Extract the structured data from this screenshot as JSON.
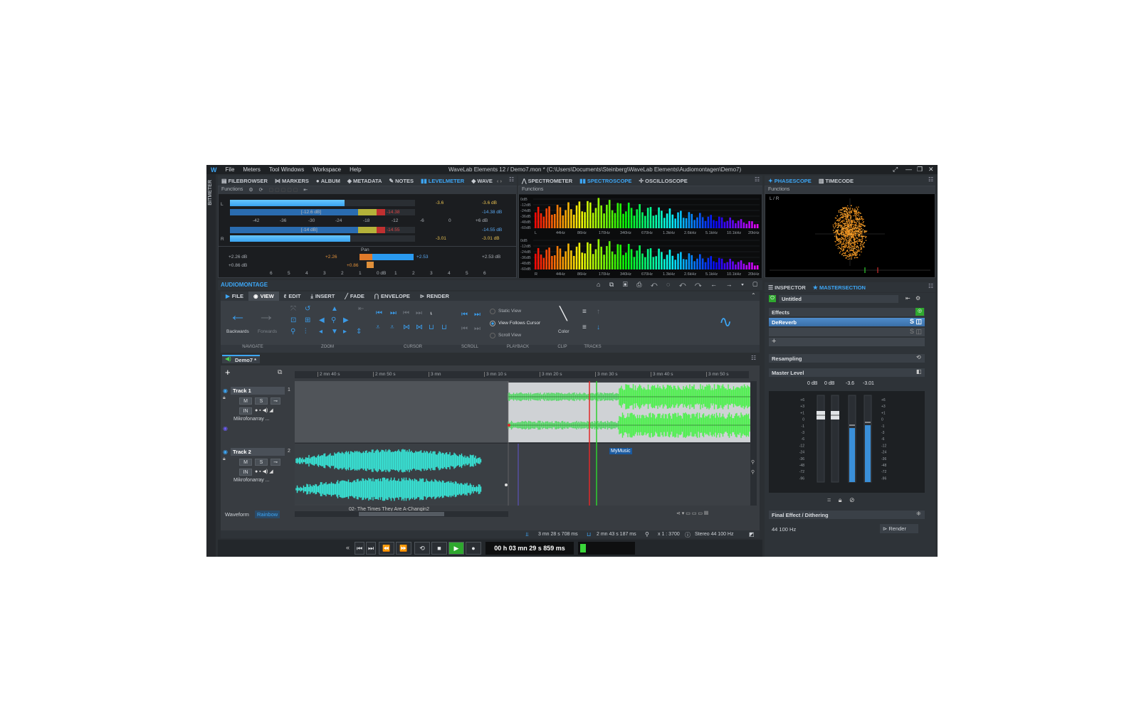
{
  "window": {
    "title": "WaveLab Elements 12 / Demo7.mon * (C:\\Users\\Documents\\Steinberg\\WaveLab Elements\\Audiomontagen\\Demo7)",
    "menu": [
      "File",
      "Meters",
      "Tool Windows",
      "Workspace",
      "Help"
    ]
  },
  "side_label": "BITMETER",
  "top_left_tabs": [
    "FILEBROWSER",
    "MARKERS",
    "ALBUM",
    "METADATA",
    "NOTES",
    "LEVELMETER",
    "WAVE"
  ],
  "top_left_active": "LEVELMETER",
  "functions_label": "Functions",
  "levelmeter": {
    "channels": [
      "L",
      "R"
    ],
    "scale": [
      "-42",
      "-36",
      "-30",
      "-24",
      "-18",
      "-12",
      "-6",
      "0",
      "+6 dB"
    ],
    "scale_lower": [
      "-42",
      "-36",
      "-30",
      "-24",
      "-18",
      "-12",
      "-6",
      "0",
      "+6 dB"
    ],
    "left_peak_box": "[-12.6 dB]",
    "right_peak_box": "[-14 dB]",
    "left_hold": "-3.6",
    "left_val_1": "-3.6 dB",
    "left_val_2": "-14.38 dB",
    "right_hold": "-3.01",
    "right_val_1": "-14.55 dB",
    "right_val_2": "-3.01 dB",
    "red_1": "-14.38",
    "red_2": "-14.55",
    "pan_label": "Pan",
    "pan_left_1": "+2.26 dB",
    "pan_left_2": "+0.86 dB",
    "pan_mid_1": "+2.26",
    "pan_mid_2": "+0.86",
    "pan_right_1": "+2.53",
    "pan_right_2": "+2.53 dB",
    "pan_scale": [
      "6",
      "5",
      "4",
      "3",
      "2",
      "1",
      "0 dB",
      "1",
      "2",
      "3",
      "4",
      "5",
      "6"
    ],
    "left_level_pct": 62,
    "right_level_pct": 65
  },
  "spectrum_tabs": [
    "SPECTROMETER",
    "SPECTROSCOPE",
    "OSCILLOSCOPE"
  ],
  "spectrum_active": "SPECTROSCOPE",
  "spectrum": {
    "db_scale": [
      "0dB",
      "-12dB",
      "-24dB",
      "-36dB",
      "-48dB",
      "-60dB"
    ],
    "freqs": [
      "L",
      "44Hz",
      "86Hz",
      "170Hz",
      "340Hz",
      "670Hz",
      "1.3kHz",
      "2.6kHz",
      "5.1kHz",
      "10.1kHz",
      "20kHz"
    ],
    "freqs_r": [
      "R",
      "44Hz",
      "86Hz",
      "170Hz",
      "340Hz",
      "670Hz",
      "1.3kHz",
      "2.6kHz",
      "5.1kHz",
      "10.1kHz",
      "20kHz"
    ]
  },
  "phase_tabs": [
    "PHASESCOPE",
    "TIMECODE"
  ],
  "phase_active": "PHASESCOPE",
  "phase_label": "L / R",
  "audiomontage_title": "AUDIOMONTAGE",
  "ribbon_tabs": [
    "FILE",
    "VIEW",
    "EDIT",
    "INSERT",
    "FADE",
    "ENVELOPE",
    "RENDER"
  ],
  "ribbon_active": "VIEW",
  "ribbon": {
    "backwards": "Backwards",
    "forwards": "Forwards",
    "static_view": "Static View",
    "view_follows": "View Follows Cursor",
    "scroll_view": "Scroll View",
    "color": "Color",
    "groups": [
      "NAVIGATE",
      "ZOOM",
      "CURSOR",
      "SCROLL",
      "PLAYBACK",
      "CLIP",
      "TRACKS"
    ]
  },
  "montage_tab": "Demo7 *",
  "ruler": [
    "2 mn 40 s",
    "2 mn 50 s",
    "3 mn",
    "3 mn 10 s",
    "3 mn 20 s",
    "3 mn 30 s",
    "3 mn 40 s",
    "3 mn 50 s"
  ],
  "tracks": [
    {
      "name": "Track 1",
      "num": "1",
      "input": "Mikrofonarray ...",
      "m": "M",
      "s": "S",
      "in": "IN"
    },
    {
      "name": "Track 2",
      "num": "2",
      "input": "Mikrofonarray ...",
      "m": "M",
      "s": "S",
      "in": "IN"
    }
  ],
  "clips": {
    "mymusic": "MyMusic",
    "times": "02- The Times They Are A-Changin2"
  },
  "waveform_label": "Waveform",
  "rainbow_label": "Rainbow",
  "status": {
    "pos1": "3 mn 28 s 708 ms",
    "pos2": "2 mn 43 s 187 ms",
    "zoom": "x 1 : 3700",
    "format": "Stereo 44 100 Hz"
  },
  "transport_time": "00 h 03 mn 29 s 859 ms",
  "inspector_tabs": [
    "INSPECTOR",
    "MASTERSECTION"
  ],
  "inspector_active": "MASTERSECTION",
  "inspector": {
    "preset": "Untitled",
    "effects": "Effects",
    "plugin": "DeReverb",
    "resampling": "Resampling",
    "master_level": "Master Level",
    "levels": [
      "0 dB",
      "0 dB",
      "-3.6",
      "-3.01"
    ],
    "fader_scale": [
      "+6",
      "+3",
      "+1",
      "0",
      "-1",
      "-3",
      "-6",
      "-12",
      "-24",
      "-36",
      "-48",
      "-72",
      "-96"
    ],
    "final": "Final Effect / Dithering",
    "rate": "44 100 Hz",
    "render": "Render"
  },
  "colors": {
    "accent": "#3da6f5",
    "wave_green": "#4df04d",
    "wave_cyan": "#38e6d8",
    "cursor_red": "#e02828"
  }
}
